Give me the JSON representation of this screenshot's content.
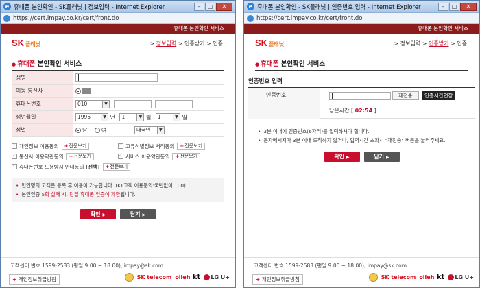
{
  "window1": {
    "title": "휴대폰 본인확인 - SK플래닛 | 정보입력 - Internet Explorer",
    "url": "https://cert.impay.co.kr/cert/front.do",
    "header_band": "휴대폰 본인확인 서비스",
    "steps": {
      "step1": "정보입력",
      "step2": "인증받기",
      "step3": "인증"
    },
    "section_title_red": "휴대폰",
    "section_title_rest": " 본인확인 서비스",
    "form": {
      "name_label": "성명",
      "carrier_label": "이동 통신사",
      "phone_label": "휴대폰번호",
      "phone_prefix": "010",
      "birth_label": "생년월일",
      "birth_year": "1995",
      "year_unit": "년",
      "birth_month": "1",
      "month_unit": "월",
      "birth_day": "1",
      "day_unit": "일",
      "gender_label": "성별",
      "male": "남",
      "female": "여",
      "nationality": "내국인"
    },
    "agreements": {
      "privacy": "개인정보 이용동의",
      "unique_id": "고유식별정보 처리동의",
      "carrier_terms": "통신사 이용약관동의",
      "service_terms": "서비스 이용약관동의",
      "theft_notice": "휴대폰번호 도용방지 안내동의",
      "optional": "[선택]",
      "view": "전문보기",
      "plus": "+"
    },
    "notice": {
      "line1": "법인명의 고객은 등록 후 이용이 가능합니다. (KT고객 이용문의:국번없이 100)",
      "line2_pre": "본인인증 ",
      "line2_red": "5회 실패 시, 당일 휴대폰 인증이 제한",
      "line2_post": "됩니다."
    },
    "buttons": {
      "confirm": "확인",
      "close": "닫기",
      "arrow": "▶"
    }
  },
  "window2": {
    "title": "휴대폰 본인확인 - SK플래닛 | 인증번호 입력 - Internet Explorer",
    "url": "https://cert.impay.co.kr/cert/front.do",
    "header_band": "휴대폰 본인확인 서비스",
    "steps": {
      "step1": "정보입력",
      "step2": "인증받기",
      "step3": "인증"
    },
    "section_title_red": "휴대폰",
    "section_title_rest": " 본인확인 서비스",
    "auth_title": "인증번호 입력",
    "auth_label": "인증번호",
    "resend": "재전송",
    "extend": "인증시간연장",
    "remain_label": "남은시간",
    "timer": "02:54",
    "notice": {
      "line1": "3분 이내에 인증번호(6자리)를 입력하셔야 합니다.",
      "line2": "문자메시지가 3분 이내 도착하지 않거나, 입력시간 초과시 \"재전송\" 버튼을 눌러주세요."
    },
    "buttons": {
      "confirm": "확인",
      "close": "닫기",
      "arrow": "▶"
    }
  },
  "footer": {
    "text": "고객센터 번호 1599-2583 (평일 9:00 ~ 18:00),  impay@sk.com",
    "privacy": "개인정보취급방침",
    "plus": "+",
    "sk_telecom": "SK telecom",
    "olleh": "olleh",
    "kt": "kt",
    "lg": "LG U+"
  },
  "logo": {
    "sk": "SK",
    "planet": "플래닛"
  },
  "title_buttons": {
    "min": "–",
    "max": "□",
    "close": "✕"
  },
  "colors": {
    "brand_red": "#c8102e",
    "header_band": "#8c1c1c",
    "label_bg": "#f9e7e7"
  }
}
